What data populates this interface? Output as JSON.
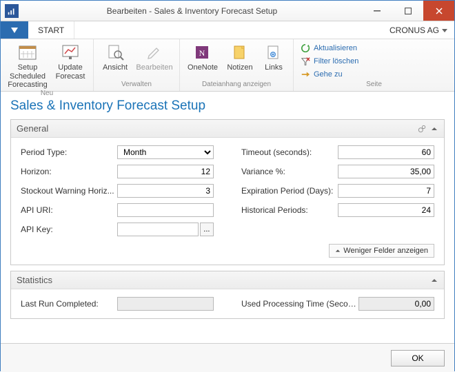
{
  "window": {
    "title": "Bearbeiten - Sales & Inventory Forecast Setup"
  },
  "ribbonTabs": {
    "start": "START",
    "company": "CRONUS AG"
  },
  "ribbon": {
    "neu": {
      "setupSchedLine1": "Setup Scheduled",
      "setupSchedLine2": "Forecasting",
      "updateLine1": "Update",
      "updateLine2": "Forecast",
      "groupLabel": "Neu"
    },
    "verwalten": {
      "ansicht": "Ansicht",
      "bearbeiten": "Bearbeiten",
      "groupLabel": "Verwalten"
    },
    "anhang": {
      "onenote": "OneNote",
      "notizen": "Notizen",
      "links": "Links",
      "groupLabel": "Dateianhang anzeigen"
    },
    "seite": {
      "aktualisieren": "Aktualisieren",
      "filterLoeschen": "Filter löschen",
      "geheZu": "Gehe zu",
      "groupLabel": "Seite"
    }
  },
  "page": {
    "title": "Sales & Inventory Forecast Setup"
  },
  "general": {
    "header": "General",
    "periodTypeLabel": "Period Type:",
    "periodTypeValue": "Month",
    "horizonLabel": "Horizon:",
    "horizonValue": "12",
    "stockoutLabel": "Stockout Warning Horiz...",
    "stockoutValue": "3",
    "apiUriLabel": "API URI:",
    "apiUriValue": "",
    "apiKeyLabel": "API Key:",
    "apiKeyValue": "",
    "apiKeyAssist": "...",
    "timeoutLabel": "Timeout (seconds):",
    "timeoutValue": "60",
    "varianceLabel": "Variance %:",
    "varianceValue": "35,00",
    "expirationLabel": "Expiration Period (Days):",
    "expirationValue": "7",
    "historicalLabel": "Historical Periods:",
    "historicalValue": "24",
    "showFewer": "Weniger Felder anzeigen"
  },
  "statistics": {
    "header": "Statistics",
    "lastRunLabel": "Last Run Completed:",
    "lastRunValue": "",
    "usedTimeLabel": "Used Processing Time (Secon...",
    "usedTimeValue": "0,00"
  },
  "footer": {
    "ok": "OK"
  }
}
